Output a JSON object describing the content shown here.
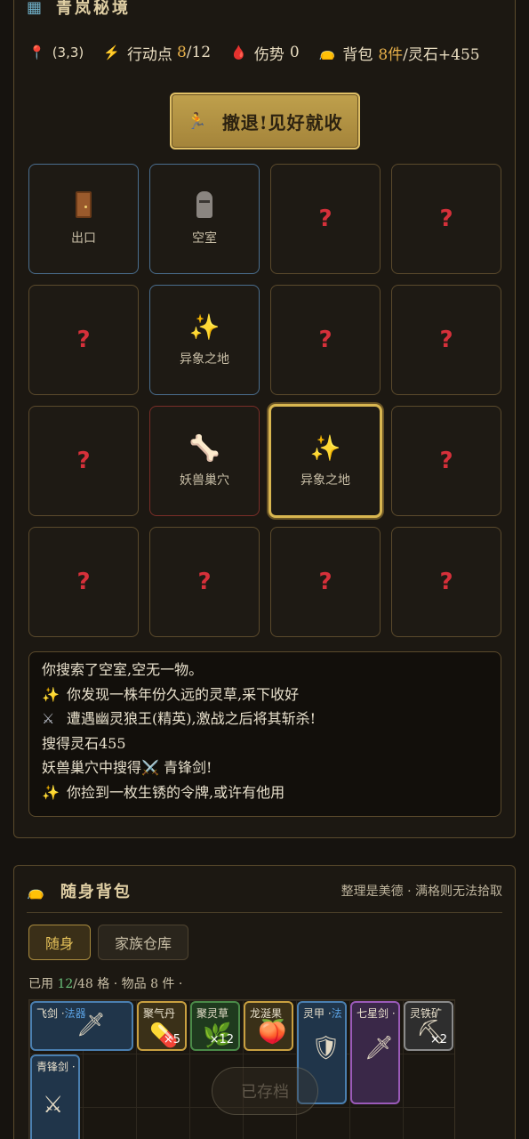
{
  "header": {
    "icon": "map-icon",
    "title": "青岚秘境"
  },
  "stats": {
    "coord": "(3,3)",
    "action_label": "行动点",
    "action_value": "8",
    "action_max": "/12",
    "injury_label": "伤势",
    "injury_value": "0",
    "bag_label": "背包",
    "bag_count": "8件",
    "bag_stones": "/灵石+455"
  },
  "retreat_button": {
    "icon": "running-person-icon",
    "label": "撤退!见好就收"
  },
  "grid": {
    "rows": [
      [
        {
          "state": "explored",
          "icon": "door-icon",
          "label": "出口"
        },
        {
          "state": "explored",
          "icon": "moai-icon",
          "label": "空室"
        },
        {
          "state": "unknown",
          "label": "?"
        },
        {
          "state": "unknown",
          "label": "?"
        }
      ],
      [
        {
          "state": "unknown",
          "label": "?"
        },
        {
          "state": "explored",
          "icon": "sparkles-icon",
          "label": "异象之地"
        },
        {
          "state": "unknown",
          "label": "?"
        },
        {
          "state": "unknown",
          "label": "?"
        }
      ],
      [
        {
          "state": "unknown",
          "label": "?"
        },
        {
          "state": "danger",
          "icon": "bone-icon",
          "label": "妖兽巢穴"
        },
        {
          "state": "current",
          "icon": "sparkles-icon",
          "label": "异象之地"
        },
        {
          "state": "unknown",
          "label": "?"
        }
      ],
      [
        {
          "state": "unknown",
          "label": "?"
        },
        {
          "state": "unknown",
          "label": "?"
        },
        {
          "state": "unknown",
          "label": "?"
        },
        {
          "state": "unknown",
          "label": "?"
        }
      ]
    ]
  },
  "log": [
    {
      "icon": "",
      "text": "你搜索了空室,空无一物。"
    },
    {
      "icon": "sparkles-icon",
      "text": "你发现一株年份久远的灵草,采下收好"
    },
    {
      "icon": "crossed-swords-icon",
      "text": "遭遇幽灵狼王(精英),激战之后将其斩杀!"
    },
    {
      "icon": "",
      "text": "搜得灵石455"
    },
    {
      "icon": "",
      "text": "妖兽巢穴中搜得⚔️ 青锋剑!"
    },
    {
      "icon": "sparkles-icon",
      "text": "你捡到一枚生锈的令牌,或许有他用"
    }
  ],
  "bag": {
    "icon": "red-pouch-icon",
    "title": "随身背包",
    "hint": "整理是美德 · 满格则无法拾取",
    "tabs": [
      {
        "label": "随身",
        "active": true
      },
      {
        "label": "家族仓库",
        "active": false
      }
    ],
    "used_prefix": "已用 ",
    "used_value": "12",
    "used_suffix": "/48 格 · 物品 8 件 ·",
    "items": [
      {
        "name": "飞剑 ·",
        "tag": "法器",
        "icon": "sword-icon",
        "qty": "",
        "color": "blue"
      },
      {
        "name": "聚气丹",
        "tag": "",
        "icon": "pill-icon",
        "qty": "×5",
        "color": "gold"
      },
      {
        "name": "聚灵草",
        "tag": "",
        "icon": "herb-icon",
        "qty": "×12",
        "color": "green"
      },
      {
        "name": "龙涎果",
        "tag": "",
        "icon": "peach-icon",
        "qty": "",
        "color": "gold"
      },
      {
        "name": "灵甲 ·",
        "tag": "法",
        "icon": "shield-icon",
        "qty": "",
        "color": "blue"
      },
      {
        "name": "七星剑 ·",
        "tag": "",
        "icon": "dagger-icon",
        "qty": "",
        "color": "purple"
      },
      {
        "name": "灵铁矿",
        "tag": "",
        "icon": "ore-icon",
        "qty": "×2",
        "color": "gray"
      },
      {
        "name": "青锋剑 ·",
        "tag": "",
        "icon": "crossed-swords-icon",
        "qty": "",
        "color": "blue"
      }
    ],
    "saved_badge": "已存档"
  }
}
